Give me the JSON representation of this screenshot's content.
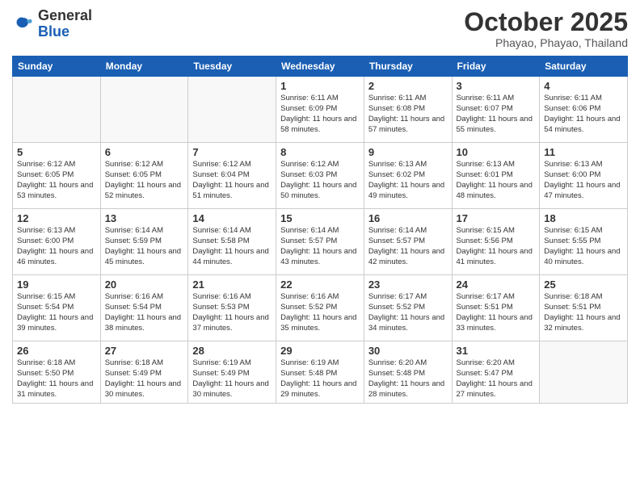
{
  "header": {
    "logo_general": "General",
    "logo_blue": "Blue",
    "month_title": "October 2025",
    "location": "Phayao, Phayao, Thailand"
  },
  "weekdays": [
    "Sunday",
    "Monday",
    "Tuesday",
    "Wednesday",
    "Thursday",
    "Friday",
    "Saturday"
  ],
  "weeks": [
    [
      {
        "day": "",
        "info": ""
      },
      {
        "day": "",
        "info": ""
      },
      {
        "day": "",
        "info": ""
      },
      {
        "day": "1",
        "info": "Sunrise: 6:11 AM\nSunset: 6:09 PM\nDaylight: 11 hours\nand 58 minutes."
      },
      {
        "day": "2",
        "info": "Sunrise: 6:11 AM\nSunset: 6:08 PM\nDaylight: 11 hours\nand 57 minutes."
      },
      {
        "day": "3",
        "info": "Sunrise: 6:11 AM\nSunset: 6:07 PM\nDaylight: 11 hours\nand 55 minutes."
      },
      {
        "day": "4",
        "info": "Sunrise: 6:11 AM\nSunset: 6:06 PM\nDaylight: 11 hours\nand 54 minutes."
      }
    ],
    [
      {
        "day": "5",
        "info": "Sunrise: 6:12 AM\nSunset: 6:05 PM\nDaylight: 11 hours\nand 53 minutes."
      },
      {
        "day": "6",
        "info": "Sunrise: 6:12 AM\nSunset: 6:05 PM\nDaylight: 11 hours\nand 52 minutes."
      },
      {
        "day": "7",
        "info": "Sunrise: 6:12 AM\nSunset: 6:04 PM\nDaylight: 11 hours\nand 51 minutes."
      },
      {
        "day": "8",
        "info": "Sunrise: 6:12 AM\nSunset: 6:03 PM\nDaylight: 11 hours\nand 50 minutes."
      },
      {
        "day": "9",
        "info": "Sunrise: 6:13 AM\nSunset: 6:02 PM\nDaylight: 11 hours\nand 49 minutes."
      },
      {
        "day": "10",
        "info": "Sunrise: 6:13 AM\nSunset: 6:01 PM\nDaylight: 11 hours\nand 48 minutes."
      },
      {
        "day": "11",
        "info": "Sunrise: 6:13 AM\nSunset: 6:00 PM\nDaylight: 11 hours\nand 47 minutes."
      }
    ],
    [
      {
        "day": "12",
        "info": "Sunrise: 6:13 AM\nSunset: 6:00 PM\nDaylight: 11 hours\nand 46 minutes."
      },
      {
        "day": "13",
        "info": "Sunrise: 6:14 AM\nSunset: 5:59 PM\nDaylight: 11 hours\nand 45 minutes."
      },
      {
        "day": "14",
        "info": "Sunrise: 6:14 AM\nSunset: 5:58 PM\nDaylight: 11 hours\nand 44 minutes."
      },
      {
        "day": "15",
        "info": "Sunrise: 6:14 AM\nSunset: 5:57 PM\nDaylight: 11 hours\nand 43 minutes."
      },
      {
        "day": "16",
        "info": "Sunrise: 6:14 AM\nSunset: 5:57 PM\nDaylight: 11 hours\nand 42 minutes."
      },
      {
        "day": "17",
        "info": "Sunrise: 6:15 AM\nSunset: 5:56 PM\nDaylight: 11 hours\nand 41 minutes."
      },
      {
        "day": "18",
        "info": "Sunrise: 6:15 AM\nSunset: 5:55 PM\nDaylight: 11 hours\nand 40 minutes."
      }
    ],
    [
      {
        "day": "19",
        "info": "Sunrise: 6:15 AM\nSunset: 5:54 PM\nDaylight: 11 hours\nand 39 minutes."
      },
      {
        "day": "20",
        "info": "Sunrise: 6:16 AM\nSunset: 5:54 PM\nDaylight: 11 hours\nand 38 minutes."
      },
      {
        "day": "21",
        "info": "Sunrise: 6:16 AM\nSunset: 5:53 PM\nDaylight: 11 hours\nand 37 minutes."
      },
      {
        "day": "22",
        "info": "Sunrise: 6:16 AM\nSunset: 5:52 PM\nDaylight: 11 hours\nand 35 minutes."
      },
      {
        "day": "23",
        "info": "Sunrise: 6:17 AM\nSunset: 5:52 PM\nDaylight: 11 hours\nand 34 minutes."
      },
      {
        "day": "24",
        "info": "Sunrise: 6:17 AM\nSunset: 5:51 PM\nDaylight: 11 hours\nand 33 minutes."
      },
      {
        "day": "25",
        "info": "Sunrise: 6:18 AM\nSunset: 5:51 PM\nDaylight: 11 hours\nand 32 minutes."
      }
    ],
    [
      {
        "day": "26",
        "info": "Sunrise: 6:18 AM\nSunset: 5:50 PM\nDaylight: 11 hours\nand 31 minutes."
      },
      {
        "day": "27",
        "info": "Sunrise: 6:18 AM\nSunset: 5:49 PM\nDaylight: 11 hours\nand 30 minutes."
      },
      {
        "day": "28",
        "info": "Sunrise: 6:19 AM\nSunset: 5:49 PM\nDaylight: 11 hours\nand 30 minutes."
      },
      {
        "day": "29",
        "info": "Sunrise: 6:19 AM\nSunset: 5:48 PM\nDaylight: 11 hours\nand 29 minutes."
      },
      {
        "day": "30",
        "info": "Sunrise: 6:20 AM\nSunset: 5:48 PM\nDaylight: 11 hours\nand 28 minutes."
      },
      {
        "day": "31",
        "info": "Sunrise: 6:20 AM\nSunset: 5:47 PM\nDaylight: 11 hours\nand 27 minutes."
      },
      {
        "day": "",
        "info": ""
      }
    ]
  ]
}
